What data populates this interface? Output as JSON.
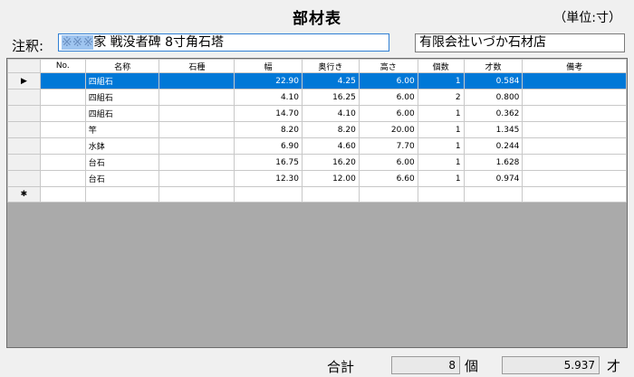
{
  "window": {
    "title": "部材表",
    "unit_label": "（単位:寸）"
  },
  "note": {
    "label": "注釈:",
    "selected_text": "※※※",
    "value": "家 戦没者碑 8寸角石塔"
  },
  "shop_name": "有限会社いづか石材店",
  "table": {
    "columns": [
      "No.",
      "名称",
      "石種",
      "幅",
      "奥行き",
      "高さ",
      "個数",
      "才数",
      "備考"
    ],
    "rows": [
      {
        "no": "",
        "name": "四組石",
        "stone": "",
        "width": "22.90",
        "depth": "4.25",
        "height": "6.00",
        "count": "1",
        "sai": "0.584",
        "note": ""
      },
      {
        "no": "",
        "name": "四組石",
        "stone": "",
        "width": "4.10",
        "depth": "16.25",
        "height": "6.00",
        "count": "2",
        "sai": "0.800",
        "note": ""
      },
      {
        "no": "",
        "name": "四組石",
        "stone": "",
        "width": "14.70",
        "depth": "4.10",
        "height": "6.00",
        "count": "1",
        "sai": "0.362",
        "note": ""
      },
      {
        "no": "",
        "name": "竿",
        "stone": "",
        "width": "8.20",
        "depth": "8.20",
        "height": "20.00",
        "count": "1",
        "sai": "1.345",
        "note": ""
      },
      {
        "no": "",
        "name": "水鉢",
        "stone": "",
        "width": "6.90",
        "depth": "4.60",
        "height": "7.70",
        "count": "1",
        "sai": "0.244",
        "note": ""
      },
      {
        "no": "",
        "name": "台石",
        "stone": "",
        "width": "16.75",
        "depth": "16.20",
        "height": "6.00",
        "count": "1",
        "sai": "1.628",
        "note": ""
      },
      {
        "no": "",
        "name": "台石",
        "stone": "",
        "width": "12.30",
        "depth": "12.00",
        "height": "6.60",
        "count": "1",
        "sai": "0.974",
        "note": ""
      }
    ],
    "current_row_marker": "▶",
    "new_row_marker": "✱"
  },
  "footer": {
    "total_label": "合計",
    "count_value": "8",
    "count_unit": "個",
    "sai_value": "5.937",
    "sai_unit": "才"
  }
}
